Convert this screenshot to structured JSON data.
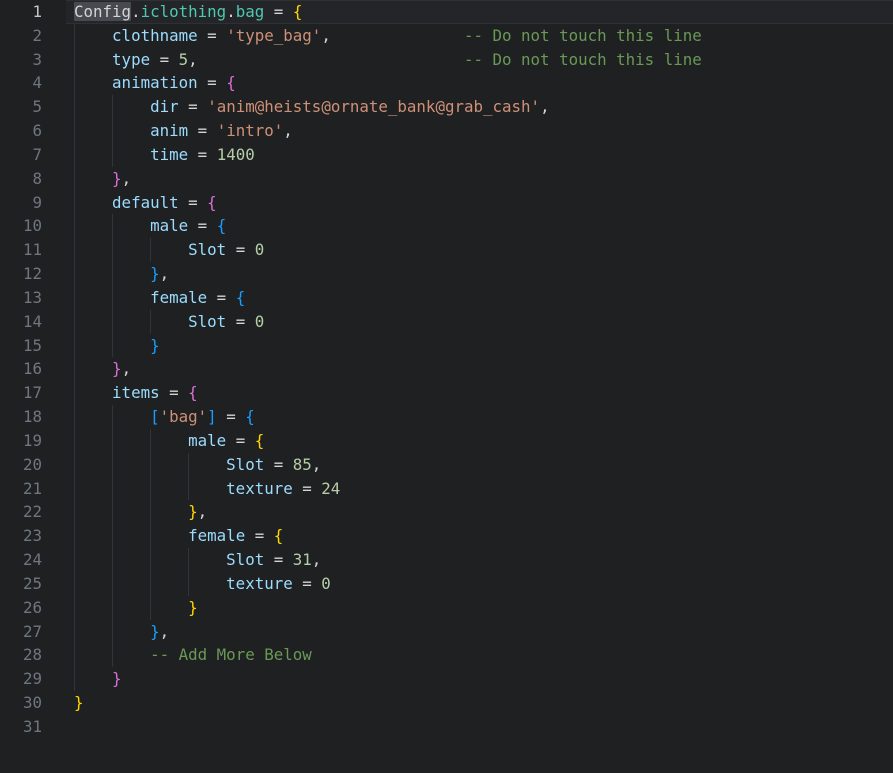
{
  "editor": {
    "description": "code-editor-lua-config",
    "palette": {
      "bg": "#1f2022",
      "fg": "#d4d4d4",
      "prop": "#9cdcfe",
      "str": "#ce9178",
      "num": "#b5cea8",
      "com": "#6a9955",
      "b1": "#ffd700",
      "b2": "#da70d6",
      "b3": "#179fff",
      "teal": "#4ec9b0",
      "gutter_fg": "#6e7681",
      "gutter_active_fg": "#c6c6c6",
      "line_highlight_bg": "#242528",
      "line_highlight_border": "#2d3034",
      "word_highlight_bg": "#474b51",
      "indent_guide": "#313438"
    },
    "lines": [
      {
        "num": "1",
        "active": true,
        "guides": 0,
        "tokens": [
          [
            "Config",
            "fg",
            "hl"
          ],
          [
            ".",
            "fg"
          ],
          [
            "iclothing",
            "teal"
          ],
          [
            ".",
            "fg"
          ],
          [
            "bag",
            "teal"
          ],
          [
            " = ",
            "fg"
          ],
          [
            "{",
            "b1"
          ]
        ]
      },
      {
        "num": "2",
        "guides": 1,
        "tokens": [
          [
            "    ",
            "fg"
          ],
          [
            "clothname",
            "prop"
          ],
          [
            " = ",
            "fg"
          ],
          [
            "'type_bag'",
            "str"
          ],
          [
            ",",
            "fg"
          ],
          [
            "              ",
            "fg"
          ],
          [
            "-- Do not touch this line",
            "com"
          ]
        ]
      },
      {
        "num": "3",
        "guides": 1,
        "tokens": [
          [
            "    ",
            "fg"
          ],
          [
            "type",
            "prop"
          ],
          [
            " = ",
            "fg"
          ],
          [
            "5",
            "num"
          ],
          [
            ",",
            "fg"
          ],
          [
            "                            ",
            "fg"
          ],
          [
            "-- Do not touch this line",
            "com"
          ]
        ]
      },
      {
        "num": "4",
        "guides": 1,
        "tokens": [
          [
            "    ",
            "fg"
          ],
          [
            "animation",
            "prop"
          ],
          [
            " = ",
            "fg"
          ],
          [
            "{",
            "b2"
          ]
        ]
      },
      {
        "num": "5",
        "guides": 2,
        "tokens": [
          [
            "        ",
            "fg"
          ],
          [
            "dir",
            "prop"
          ],
          [
            " = ",
            "fg"
          ],
          [
            "'anim@heists@ornate_bank@grab_cash'",
            "str"
          ],
          [
            ",",
            "fg"
          ]
        ]
      },
      {
        "num": "6",
        "guides": 2,
        "tokens": [
          [
            "        ",
            "fg"
          ],
          [
            "anim",
            "prop"
          ],
          [
            " = ",
            "fg"
          ],
          [
            "'intro'",
            "str"
          ],
          [
            ",",
            "fg"
          ]
        ]
      },
      {
        "num": "7",
        "guides": 2,
        "tokens": [
          [
            "        ",
            "fg"
          ],
          [
            "time",
            "prop"
          ],
          [
            " = ",
            "fg"
          ],
          [
            "1400",
            "num"
          ]
        ]
      },
      {
        "num": "8",
        "guides": 1,
        "tokens": [
          [
            "    ",
            "fg"
          ],
          [
            "}",
            "b2"
          ],
          [
            ",",
            "fg"
          ]
        ]
      },
      {
        "num": "9",
        "guides": 1,
        "tokens": [
          [
            "    ",
            "fg"
          ],
          [
            "default",
            "prop"
          ],
          [
            " = ",
            "fg"
          ],
          [
            "{",
            "b2"
          ]
        ]
      },
      {
        "num": "10",
        "guides": 2,
        "tokens": [
          [
            "        ",
            "fg"
          ],
          [
            "male",
            "prop"
          ],
          [
            " = ",
            "fg"
          ],
          [
            "{",
            "b3"
          ]
        ]
      },
      {
        "num": "11",
        "guides": 3,
        "tokens": [
          [
            "            ",
            "fg"
          ],
          [
            "Slot",
            "prop"
          ],
          [
            " = ",
            "fg"
          ],
          [
            "0",
            "num"
          ]
        ]
      },
      {
        "num": "12",
        "guides": 2,
        "tokens": [
          [
            "        ",
            "fg"
          ],
          [
            "}",
            "b3"
          ],
          [
            ",",
            "fg"
          ]
        ]
      },
      {
        "num": "13",
        "guides": 2,
        "tokens": [
          [
            "        ",
            "fg"
          ],
          [
            "female",
            "prop"
          ],
          [
            " = ",
            "fg"
          ],
          [
            "{",
            "b3"
          ]
        ]
      },
      {
        "num": "14",
        "guides": 3,
        "tokens": [
          [
            "            ",
            "fg"
          ],
          [
            "Slot",
            "prop"
          ],
          [
            " = ",
            "fg"
          ],
          [
            "0",
            "num"
          ]
        ]
      },
      {
        "num": "15",
        "guides": 2,
        "tokens": [
          [
            "        ",
            "fg"
          ],
          [
            "}",
            "b3"
          ]
        ]
      },
      {
        "num": "16",
        "guides": 1,
        "tokens": [
          [
            "    ",
            "fg"
          ],
          [
            "}",
            "b2"
          ],
          [
            ",",
            "fg"
          ]
        ]
      },
      {
        "num": "17",
        "guides": 1,
        "tokens": [
          [
            "    ",
            "fg"
          ],
          [
            "items",
            "prop"
          ],
          [
            " = ",
            "fg"
          ],
          [
            "{",
            "b2"
          ]
        ]
      },
      {
        "num": "18",
        "guides": 2,
        "tokens": [
          [
            "        ",
            "fg"
          ],
          [
            "[",
            "b3"
          ],
          [
            "'bag'",
            "str"
          ],
          [
            "]",
            "b3"
          ],
          [
            " = ",
            "fg"
          ],
          [
            "{",
            "b3"
          ]
        ]
      },
      {
        "num": "19",
        "guides": 3,
        "tokens": [
          [
            "            ",
            "fg"
          ],
          [
            "male",
            "prop"
          ],
          [
            " = ",
            "fg"
          ],
          [
            "{",
            "b1"
          ]
        ]
      },
      {
        "num": "20",
        "guides": 4,
        "tokens": [
          [
            "                ",
            "fg"
          ],
          [
            "Slot",
            "prop"
          ],
          [
            " = ",
            "fg"
          ],
          [
            "85",
            "num"
          ],
          [
            ",",
            "fg"
          ]
        ]
      },
      {
        "num": "21",
        "guides": 4,
        "tokens": [
          [
            "                ",
            "fg"
          ],
          [
            "texture",
            "prop"
          ],
          [
            " = ",
            "fg"
          ],
          [
            "24",
            "num"
          ]
        ]
      },
      {
        "num": "22",
        "guides": 3,
        "tokens": [
          [
            "            ",
            "fg"
          ],
          [
            "}",
            "b1"
          ],
          [
            ",",
            "fg"
          ]
        ]
      },
      {
        "num": "23",
        "guides": 3,
        "tokens": [
          [
            "            ",
            "fg"
          ],
          [
            "female",
            "prop"
          ],
          [
            " = ",
            "fg"
          ],
          [
            "{",
            "b1"
          ]
        ]
      },
      {
        "num": "24",
        "guides": 4,
        "tokens": [
          [
            "                ",
            "fg"
          ],
          [
            "Slot",
            "prop"
          ],
          [
            " = ",
            "fg"
          ],
          [
            "31",
            "num"
          ],
          [
            ",",
            "fg"
          ]
        ]
      },
      {
        "num": "25",
        "guides": 4,
        "tokens": [
          [
            "                ",
            "fg"
          ],
          [
            "texture",
            "prop"
          ],
          [
            " = ",
            "fg"
          ],
          [
            "0",
            "num"
          ]
        ]
      },
      {
        "num": "26",
        "guides": 3,
        "tokens": [
          [
            "            ",
            "fg"
          ],
          [
            "}",
            "b1"
          ]
        ]
      },
      {
        "num": "27",
        "guides": 2,
        "tokens": [
          [
            "        ",
            "fg"
          ],
          [
            "}",
            "b3"
          ],
          [
            ",",
            "fg"
          ]
        ]
      },
      {
        "num": "28",
        "guides": 2,
        "tokens": [
          [
            "        ",
            "fg"
          ],
          [
            "-- Add More Below",
            "com"
          ]
        ]
      },
      {
        "num": "29",
        "guides": 1,
        "tokens": [
          [
            "    ",
            "fg"
          ],
          [
            "}",
            "b2"
          ]
        ]
      },
      {
        "num": "30",
        "guides": 0,
        "tokens": [
          [
            "}",
            "b1"
          ]
        ]
      },
      {
        "num": "31",
        "guides": 0,
        "tokens": []
      }
    ]
  }
}
